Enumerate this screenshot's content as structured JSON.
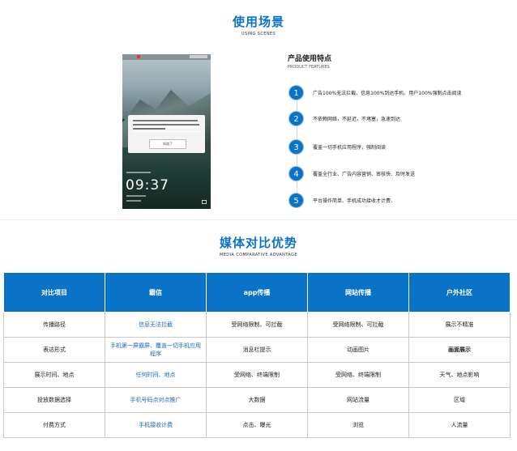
{
  "section1": {
    "title": "使用场景",
    "subtitle": "USING SCENES"
  },
  "phone": {
    "popup_button": "知道了",
    "time": "09:37"
  },
  "features": {
    "title": "产品使用特点",
    "subtitle": "PRODUCT FEATURES",
    "items": [
      {
        "num": "1",
        "text": "广告100%无法拦截、信息100%到达手机、用户100%强制点击阅读"
      },
      {
        "num": "2",
        "text": "不依赖网络，不延迟，不堵塞，急速到达"
      },
      {
        "num": "3",
        "text": "覆盖一切手机应用程序，强制阅读"
      },
      {
        "num": "4",
        "text": "覆盖全行业、广告内容营销、审核快、及时发送"
      },
      {
        "num": "5",
        "text": "平台操作简单、手机成功接收才计费、"
      }
    ]
  },
  "section2": {
    "title": "媒体对比优势",
    "subtitle": "MEDIA COMPARATIVE ADVANTAGE"
  },
  "table": {
    "headers": [
      "对比项目",
      "霸信",
      "app传播",
      "网站传播",
      "户外社区"
    ],
    "rows": [
      [
        "传播路径",
        "信息无法拦截",
        "受网络限制、可拦截",
        "受网络限制、可拦截",
        "展示不精准"
      ],
      [
        "表达形式",
        "手机第一屏霸屏、覆盖一切手机应用程序",
        "消息栏提示",
        "动画图片",
        "画面展示"
      ],
      [
        "展示时间、地点",
        "任何时间、地点",
        "受网络、终端限制",
        "受网络、终端限制",
        "天气、地点影响"
      ],
      [
        "投放数据选择",
        "手机号码点对点推广",
        "大数据",
        "网站流量",
        "区域"
      ],
      [
        "付费方式",
        "手机接收计费",
        "点击、曝光",
        "浏览",
        "人流量"
      ]
    ]
  },
  "colors": {
    "accent": "#0a73c7",
    "highlight_text": "#1d6bb5"
  }
}
